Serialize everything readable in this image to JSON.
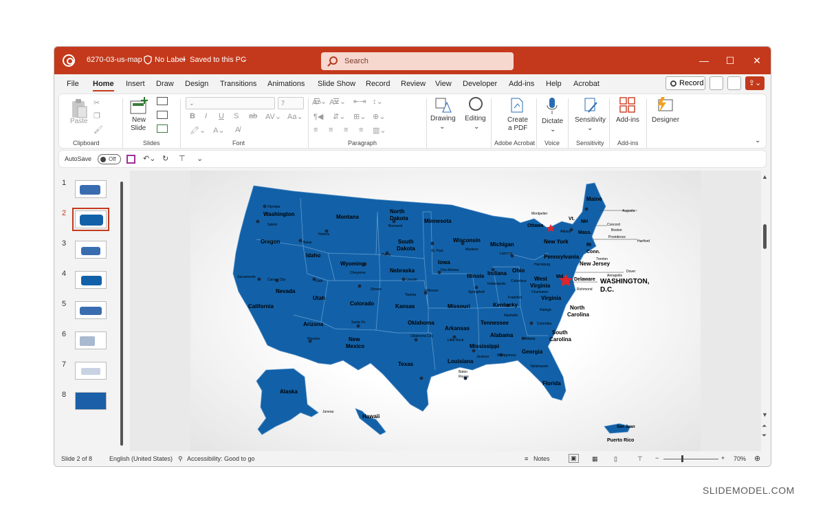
{
  "titlebar": {
    "doc_title": "6270-03-us-map",
    "label": "No Label",
    "saved": "Saved to this PC",
    "search_placeholder": "Search",
    "color": "#c4391b"
  },
  "menu": {
    "tabs": [
      "File",
      "Home",
      "Insert",
      "Draw",
      "Design",
      "Transitions",
      "Animations",
      "Slide Show",
      "Record",
      "Review",
      "View",
      "Developer",
      "Add-ins",
      "Help",
      "Acrobat"
    ],
    "active": "Home",
    "record_label": "Record"
  },
  "ribbon": {
    "paste": "Paste",
    "clipboard": "Clipboard",
    "new_slide_1": "New",
    "new_slide_2": "Slide",
    "slides": "Slides",
    "font": "Font",
    "font_size": "7",
    "paragraph": "Paragraph",
    "drawing": "Drawing",
    "editing": "Editing",
    "create_pdf_1": "Create",
    "create_pdf_2": "a PDF",
    "adobe_acrobat": "Adobe Acrobat",
    "dictate": "Dictate",
    "voice": "Voice",
    "sensitivity_btn": "Sensitivity",
    "sensitivity_grp": "Sensitivity",
    "addins_btn": "Add-ins",
    "addins_grp": "Add-ins",
    "designer": "Designer"
  },
  "qat": {
    "autosave": "AutoSave",
    "toggle": "Off"
  },
  "thumbnails": [
    "1",
    "2",
    "3",
    "4",
    "5",
    "6",
    "7",
    "8"
  ],
  "selected_slide": "2",
  "map_labels": {
    "washington": "Washington",
    "olympia": "Olympia",
    "salem": "Salem",
    "oregon": "Oregon",
    "montana": "Montana",
    "helena": "Helena",
    "boise": "Boise",
    "idaho": "Idaho",
    "north_dakota_1": "North",
    "north_dakota_2": "Dakota",
    "bismarck": "Bismarck",
    "minnesota": "Minnesota",
    "south_dakota_1": "South",
    "south_dakota_2": "Dakota",
    "pierre": "Pierre",
    "wisconsin": "Wisconsin",
    "madison": "Madison",
    "stpaul": "St. Paul",
    "wyoming": "Wyoming",
    "cheyenne": "Cheyenne",
    "nevada": "Nevada",
    "carson": "Carson City",
    "sacramento": "Sacramento",
    "california": "California",
    "utah": "Utah",
    "colorado": "Colorado",
    "denver": "Denver",
    "nebraska": "Nebraska",
    "lincoln": "Lincoln",
    "iowa": "Iowa",
    "desmoines": "Des Moines",
    "kansas": "Kansas",
    "topeka": "Topeka",
    "missouri": "Missouri",
    "jefferson": "Jefferson",
    "illinois": "Illinois",
    "springfield": "Springfield",
    "michigan": "Michigan",
    "lansing": "Lansing",
    "indiana": "Indiana",
    "indianapolis": "Indianapolis",
    "ohio": "Ohio",
    "columbus": "Columbus",
    "kentucky": "Kentucky",
    "frankfort": "Frankfort",
    "tennessee": "Tennessee",
    "nashville": "Nashville",
    "arizona": "Arizona",
    "phoenix": "Phoenix",
    "new_mexico_1": "New",
    "new_mexico_2": "Mexico",
    "santafe": "Santa Fe",
    "oklahoma": "Oklahoma",
    "okcity": "Oklahoma City",
    "texas": "Texas",
    "arkansas": "Arkansas",
    "littlerock": "Little Rock",
    "louisiana": "Louisiana",
    "batonrouge_1": "Baton",
    "batonrouge_2": "Rouge",
    "mississippi": "Mississippi",
    "jackson": "Jackson",
    "alabama": "Alabama",
    "montgomery": "Montgomery",
    "georgia": "Georgia",
    "atlanta": "Atlanta",
    "florida": "Florida",
    "tallahassee": "Tallahassee",
    "south_carolina_1": "South",
    "south_carolina_2": "Carolina",
    "columbia": "Columbia",
    "north_carolina_1": "North",
    "north_carolina_2": "Carolina",
    "raleigh": "Raleigh",
    "virginia": "Virginia",
    "richmond": "Richmond",
    "west_virginia_1": "West",
    "west_virginia_2": "Virginia",
    "charleston": "Charleston",
    "pennsylvania": "Pennsylvania",
    "harrisburg": "Harrisburg",
    "newyork": "New York",
    "albany": "Albany",
    "new_jersey": "New Jersey",
    "trenton": "Trenton",
    "delaware": "Delaware",
    "dover": "Dover",
    "annapolis": "Annapolis",
    "md": "Md.",
    "maine": "Maine",
    "augusta": "Augusta",
    "vt": "Vt.",
    "nh": "NH",
    "concord": "Concord",
    "mass": "Mass.",
    "boston": "Boston",
    "ri": "RI",
    "conn": "Conn.",
    "providence": "Providence",
    "hartford": "Hartford",
    "montpelier": "Montpelier",
    "ottawa": "Ottawa",
    "dc_1": "WASHINGTON,",
    "dc_2": "D.C.",
    "alaska": "Alaska",
    "juneau": "Juneau",
    "hawaii": "Hawaii",
    "honolulu": "Honolulu",
    "sanjuan": "San Juan",
    "puertorico": "Puerto Rico"
  },
  "map_colors": {
    "fill": "#1261a8",
    "border": "#5a92c8",
    "capital_star": "#e0242b"
  },
  "status": {
    "slide_of": "Slide 2 of 8",
    "language": "English (United States)",
    "accessibility": "Accessibility: Good to go",
    "notes": "Notes",
    "zoom": "70%"
  },
  "watermark": "SLIDEMODEL.COM"
}
